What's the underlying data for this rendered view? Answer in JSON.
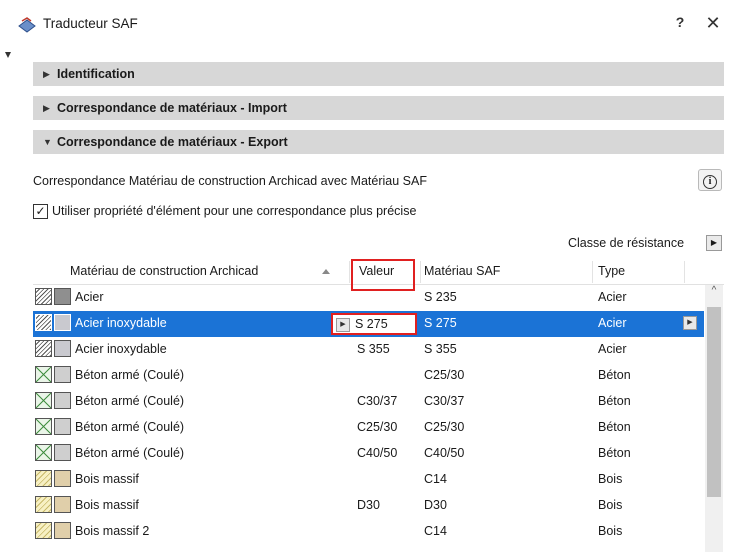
{
  "window": {
    "title": "Traducteur SAF",
    "help_label": "?",
    "close_label": "✕"
  },
  "sections": [
    {
      "label": "Identification",
      "state": "collapsed",
      "arrow": "▶"
    },
    {
      "label": "Correspondance de matériaux - Import",
      "state": "collapsed",
      "arrow": "▶"
    },
    {
      "label": "Correspondance de matériaux - Export",
      "state": "expanded",
      "arrow": "▼"
    }
  ],
  "export": {
    "description": "Correspondance Matériau de construction Archicad avec Matériau SAF",
    "info_icon": "info-icon",
    "checkbox_label": "Utiliser propriété d'élément pour une correspondance plus précise",
    "checkbox_checked": true,
    "classe_label": "Classe de résistance",
    "classe_arrow": "▶"
  },
  "table": {
    "headers": {
      "material": "Matériau de construction Archicad",
      "value": "Valeur",
      "saf": "Matériau SAF",
      "type": "Type"
    },
    "rows": [
      {
        "material": "Acier",
        "value": "",
        "saf": "S 235",
        "type": "Acier",
        "hatch": "steel",
        "fill": "steel"
      },
      {
        "material": "Acier inoxydable",
        "value": "S 275",
        "saf": "S 275",
        "type": "Acier",
        "hatch": "steel",
        "fill": "stainless",
        "selected": true
      },
      {
        "material": "Acier inoxydable",
        "value": "S 355",
        "saf": "S 355",
        "type": "Acier",
        "hatch": "steel",
        "fill": "stainless"
      },
      {
        "material": "Béton armé (Coulé)",
        "value": "",
        "saf": "C25/30",
        "type": "Béton",
        "hatch": "concrete",
        "fill": "concrete"
      },
      {
        "material": "Béton armé (Coulé)",
        "value": "C30/37",
        "saf": "C30/37",
        "type": "Béton",
        "hatch": "concrete",
        "fill": "concrete"
      },
      {
        "material": "Béton armé (Coulé)",
        "value": "C25/30",
        "saf": "C25/30",
        "type": "Béton",
        "hatch": "concrete",
        "fill": "concrete"
      },
      {
        "material": "Béton armé (Coulé)",
        "value": "C40/50",
        "saf": "C40/50",
        "type": "Béton",
        "hatch": "concrete",
        "fill": "concrete"
      },
      {
        "material": "Bois massif",
        "value": "",
        "saf": "C14",
        "type": "Bois",
        "hatch": "wood",
        "fill": "wood"
      },
      {
        "material": "Bois massif",
        "value": "D30",
        "saf": "D30",
        "type": "Bois",
        "hatch": "wood",
        "fill": "wood"
      },
      {
        "material": "Bois massif 2",
        "value": "",
        "saf": "C14",
        "type": "Bois",
        "hatch": "wood",
        "fill": "wood"
      }
    ]
  },
  "colors": {
    "selection": "#1b73d6",
    "highlight": "#e02020",
    "section_bg": "#d7d7d7"
  }
}
